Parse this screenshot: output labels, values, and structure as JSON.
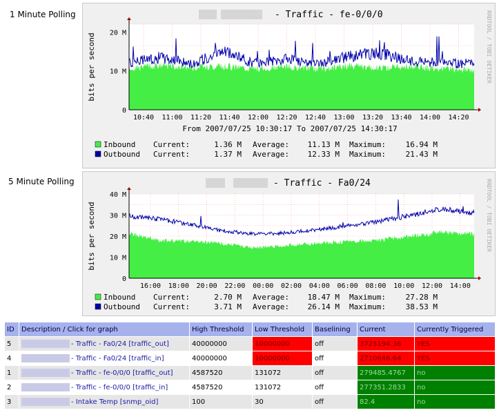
{
  "panels": [
    {
      "label": "1 Minute Polling",
      "title": "- Traffic - fe-0/0/0",
      "side_label": "RRDTOOL / TOBI OETIKER",
      "ylabel": "bits per second",
      "yticks": [
        "0",
        "10 M",
        "20 M"
      ],
      "xticks": [
        "10:40",
        "11:00",
        "11:20",
        "11:40",
        "12:00",
        "12:20",
        "12:40",
        "13:00",
        "13:20",
        "13:40",
        "14:00",
        "14:20"
      ],
      "range_text": "From 2007/07/25 10:30:17 To 2007/07/25 14:30:17",
      "legend": [
        {
          "name": "Inbound",
          "current": "1.36 M",
          "average": "11.13 M",
          "maximum": "16.94 M",
          "color": "#44ee44"
        },
        {
          "name": "Outbound",
          "current": "1.37 M",
          "average": "12.33 M",
          "maximum": "21.43 M",
          "color": "#0000aa"
        }
      ]
    },
    {
      "label": "5 Minute Polling",
      "title": "- Traffic - Fa0/24",
      "side_label": "RRDTOOL / TOBI OETIKER",
      "ylabel": "bits per second",
      "yticks": [
        "0",
        "10 M",
        "20 M",
        "30 M",
        "40 M"
      ],
      "xticks": [
        "16:00",
        "18:00",
        "20:00",
        "22:00",
        "00:00",
        "02:00",
        "04:00",
        "06:00",
        "08:00",
        "10:00",
        "12:00",
        "14:00"
      ],
      "range_text": "",
      "legend": [
        {
          "name": "Inbound",
          "current": "2.70 M",
          "average": "18.47 M",
          "maximum": "27.28 M",
          "color": "#44ee44"
        },
        {
          "name": "Outbound",
          "current": "3.71 M",
          "average": "26.14 M",
          "maximum": "38.53 M",
          "color": "#0000aa"
        }
      ]
    }
  ],
  "legend_labels": {
    "current": "Current:",
    "average": "Average:",
    "maximum": "Maximum:"
  },
  "table": {
    "headers": [
      "ID",
      "Description / Click for graph",
      "High Threshold",
      "Low Threshold",
      "Baselining",
      "Current",
      "Currently Triggered"
    ],
    "rows": [
      {
        "id": "5",
        "desc": "- Traffic - Fa0/24 [traffic_out]",
        "high": "40000000",
        "low": "10000000",
        "baselining": "off",
        "current": "3725194.36",
        "triggered": "YES",
        "low_alert": true,
        "state": "red"
      },
      {
        "id": "4",
        "desc": "- Traffic - Fa0/24 [traffic_in]",
        "high": "40000000",
        "low": "10000000",
        "baselining": "off",
        "current": "2710646.64",
        "triggered": "YES",
        "low_alert": true,
        "state": "red"
      },
      {
        "id": "1",
        "desc": "- Traffic - fe-0/0/0 [traffic_out]",
        "high": "4587520",
        "low": "131072",
        "baselining": "off",
        "current": "279485.4767",
        "triggered": "no",
        "low_alert": false,
        "state": "green"
      },
      {
        "id": "2",
        "desc": "- Traffic - fe-0/0/0 [traffic_in]",
        "high": "4587520",
        "low": "131072",
        "baselining": "off",
        "current": "277351.2833",
        "triggered": "no",
        "low_alert": false,
        "state": "green"
      },
      {
        "id": "3",
        "desc": "- Intake Temp [snmp_oid]",
        "high": "100",
        "low": "30",
        "baselining": "off",
        "current": "82.4",
        "triggered": "no",
        "low_alert": false,
        "state": "green"
      }
    ]
  },
  "chart_data": [
    {
      "type": "area",
      "title": "- Traffic - fe-0/0/0",
      "ylabel": "bits per second",
      "ylim": [
        0,
        22000000
      ],
      "x": [
        "10:40",
        "11:00",
        "11:20",
        "11:40",
        "12:00",
        "12:20",
        "12:40",
        "13:00",
        "13:20",
        "13:40",
        "14:00",
        "14:20"
      ],
      "series": [
        {
          "name": "Inbound",
          "values": [
            10500000,
            11500000,
            10800000,
            11200000,
            10600000,
            11000000,
            10400000,
            11300000,
            10800000,
            11200000,
            10500000,
            10200000
          ]
        },
        {
          "name": "Outbound",
          "values": [
            12000000,
            13500000,
            11800000,
            15000000,
            12000000,
            13000000,
            11500000,
            13800000,
            14500000,
            12500000,
            12000000,
            11800000
          ]
        }
      ]
    },
    {
      "type": "area",
      "title": "- Traffic - Fa0/24",
      "ylabel": "bits per second",
      "ylim": [
        0,
        40000000
      ],
      "x": [
        "16:00",
        "18:00",
        "20:00",
        "22:00",
        "00:00",
        "02:00",
        "04:00",
        "06:00",
        "08:00",
        "10:00",
        "12:00",
        "14:00"
      ],
      "series": [
        {
          "name": "Inbound",
          "values": [
            21000000,
            18000000,
            17500000,
            16500000,
            14500000,
            15500000,
            16500000,
            17500000,
            18000000,
            20000000,
            22000000,
            21000000
          ]
        },
        {
          "name": "Outbound",
          "values": [
            29500000,
            28000000,
            25500000,
            22500000,
            21000000,
            21500000,
            23000000,
            25000000,
            27000000,
            30000000,
            33000000,
            31000000
          ]
        }
      ]
    }
  ]
}
